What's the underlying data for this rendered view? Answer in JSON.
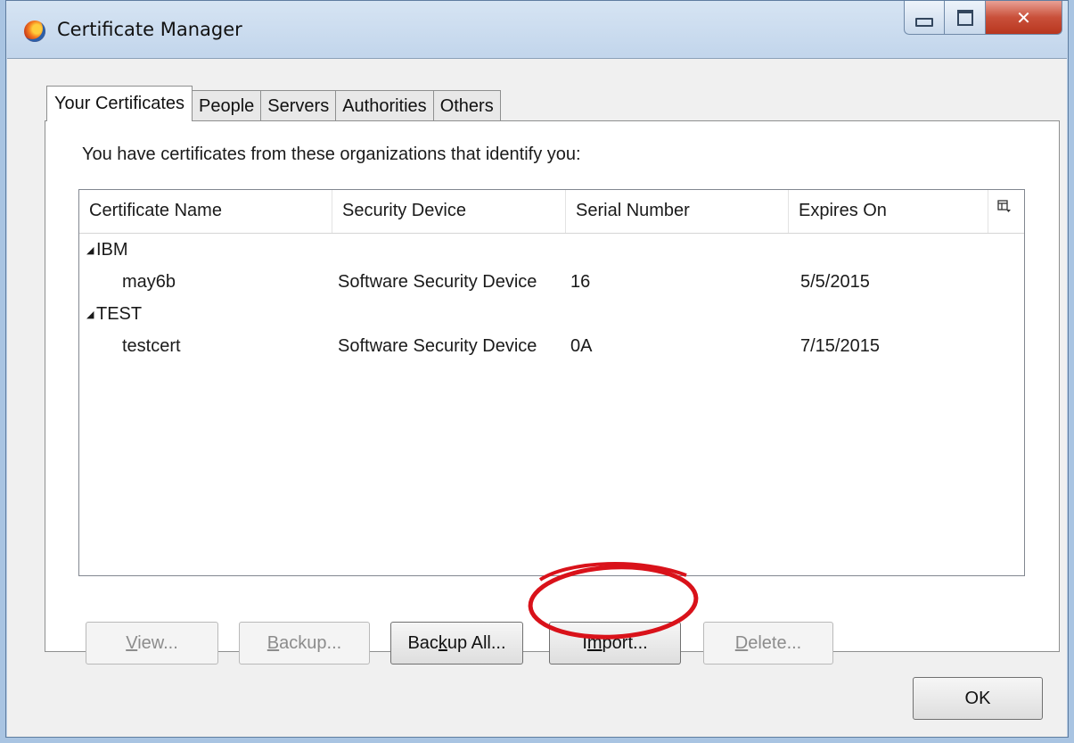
{
  "window": {
    "title": "Certificate Manager"
  },
  "tabs": [
    {
      "label": "Your Certificates",
      "active": true
    },
    {
      "label": "People",
      "active": false
    },
    {
      "label": "Servers",
      "active": false
    },
    {
      "label": "Authorities",
      "active": false
    },
    {
      "label": "Others",
      "active": false
    }
  ],
  "panel": {
    "description": "You have certificates from these organizations that identify you:"
  },
  "table": {
    "columns": [
      "Certificate Name",
      "Security Device",
      "Serial Number",
      "Expires On"
    ],
    "column_picker_icon": "column-picker-icon",
    "groups": [
      {
        "name": "IBM",
        "rows": [
          {
            "name": "may6b",
            "device": "Software Security Device",
            "serial": "16",
            "expires": "5/5/2015"
          }
        ]
      },
      {
        "name": "TEST",
        "rows": [
          {
            "name": "testcert",
            "device": "Software Security Device",
            "serial": "0A",
            "expires": "7/15/2015"
          }
        ]
      }
    ]
  },
  "buttons": {
    "view": {
      "pre": "",
      "mnemonic": "V",
      "post": "iew...",
      "enabled": false
    },
    "backup": {
      "pre": "",
      "mnemonic": "B",
      "post": "ackup...",
      "enabled": false
    },
    "backup_all": {
      "pre": "Bac",
      "mnemonic": "k",
      "post": "up All...",
      "enabled": true
    },
    "import": {
      "pre": "I",
      "mnemonic": "m",
      "post": "port...",
      "enabled": true
    },
    "delete": {
      "pre": "",
      "mnemonic": "D",
      "post": "elete...",
      "enabled": false
    }
  },
  "ok_label": "OK",
  "annotation_color": "#d9121a"
}
